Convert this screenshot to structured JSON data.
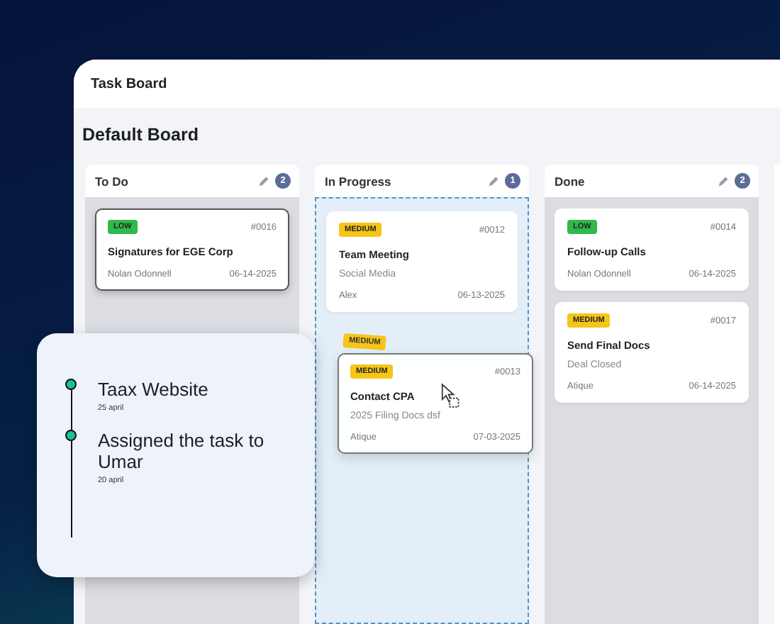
{
  "window": {
    "title": "Task Board"
  },
  "board": {
    "title": "Default Board"
  },
  "columns": [
    {
      "title": "To Do",
      "count": "2",
      "drop_target": false,
      "cards": [
        {
          "tag": "LOW",
          "color": "#2fb94a",
          "number": "#0016",
          "title": "Signatures for EGE Corp",
          "assignee": "Nolan Odonnell",
          "date": "06-14-2025",
          "selected": true
        }
      ]
    },
    {
      "title": "In Progress",
      "count": "1",
      "drop_target": true,
      "cards": [
        {
          "tag": "MEDIUM",
          "color": "#f5c518",
          "number": "#0012",
          "title": "Team Meeting",
          "subtitle": "Social Media",
          "assignee": "Alex",
          "date": "06-13-2025",
          "selected": false
        }
      ]
    },
    {
      "title": "Done",
      "count": "2",
      "drop_target": false,
      "cards": [
        {
          "tag": "LOW",
          "color": "#2fb94a",
          "number": "#0014",
          "title": "Follow-up Calls",
          "assignee": "Nolan Odonnell",
          "date": "06-14-2025",
          "selected": false
        },
        {
          "tag": "MEDIUM",
          "color": "#f5c518",
          "number": "#0017",
          "title": "Send Final Docs",
          "subtitle": "Deal Closed",
          "assignee": "Atique",
          "date": "06-14-2025",
          "selected": false
        }
      ]
    }
  ],
  "ghost": {
    "tag": "MEDIUM",
    "color": "#f5c518"
  },
  "dragging": {
    "tag": "MEDIUM",
    "color": "#f5c518",
    "number": "#0013",
    "title": "Contact CPA",
    "subtitle": "2025 Filing Docs dsf",
    "assignee": "Atique",
    "date": "07-03-2025"
  },
  "timeline": [
    {
      "title": "Taax Website",
      "date": "25 april"
    },
    {
      "title": "Assigned the task to Umar",
      "date": "20 april"
    }
  ]
}
